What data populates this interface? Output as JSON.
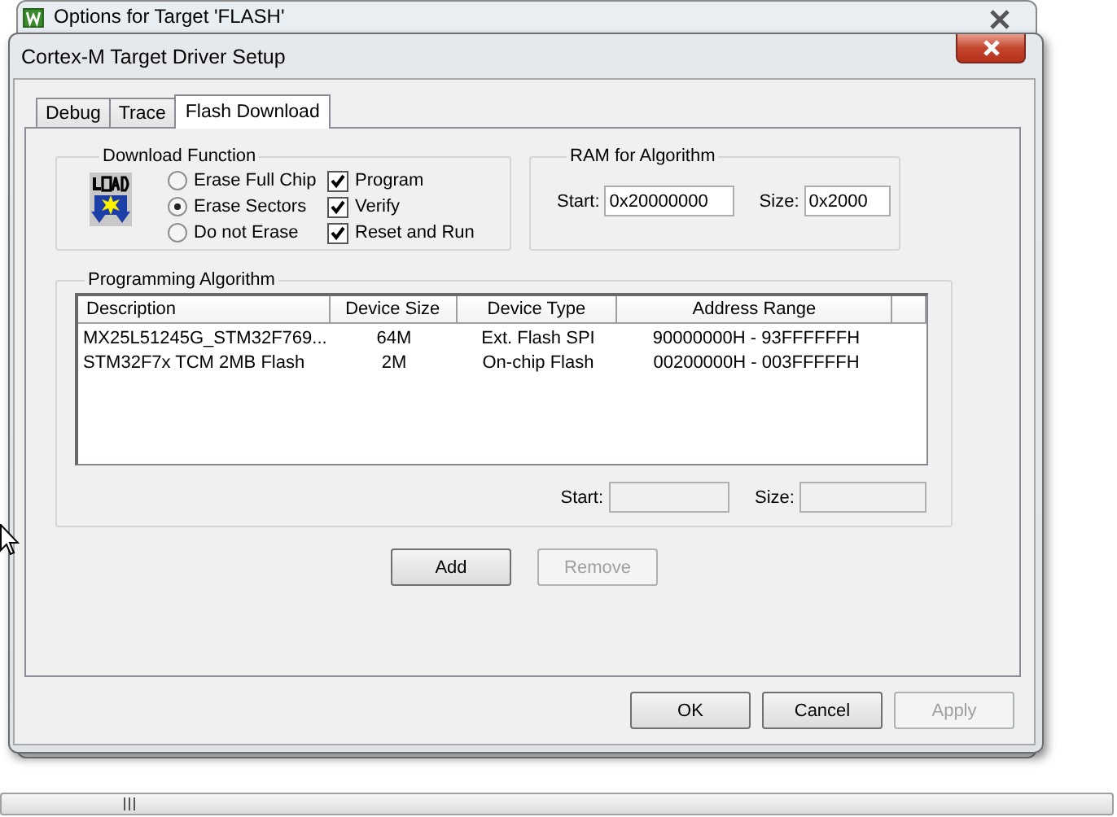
{
  "background_window": {
    "title": "Options for Target 'FLASH'"
  },
  "dialog": {
    "title": "Cortex-M Target Driver Setup"
  },
  "tabs": [
    {
      "label": "Debug",
      "selected": false
    },
    {
      "label": "Trace",
      "selected": false
    },
    {
      "label": "Flash Download",
      "selected": true
    }
  ],
  "download_function": {
    "title": "Download Function",
    "erase_options": [
      {
        "label": "Erase Full Chip",
        "selected": false
      },
      {
        "label": "Erase Sectors",
        "selected": true
      },
      {
        "label": "Do not Erase",
        "selected": false
      }
    ],
    "options": [
      {
        "label": "Program",
        "checked": true
      },
      {
        "label": "Verify",
        "checked": true
      },
      {
        "label": "Reset and Run",
        "checked": true
      }
    ]
  },
  "ram_for_algorithm": {
    "title": "RAM for Algorithm",
    "start_label": "Start:",
    "start_value": "0x20000000",
    "size_label": "Size:",
    "size_value": "0x2000"
  },
  "programming_algorithm": {
    "title": "Programming Algorithm",
    "columns": [
      "Description",
      "Device Size",
      "Device Type",
      "Address Range"
    ],
    "rows": [
      [
        "MX25L51245G_STM32F769...",
        "64M",
        "Ext. Flash SPI",
        "90000000H - 93FFFFFFH"
      ],
      [
        "STM32F7x TCM 2MB Flash",
        "2M",
        "On-chip Flash",
        "00200000H - 003FFFFFH"
      ]
    ],
    "start_label": "Start:",
    "size_label": "Size:"
  },
  "algorithm_buttons": [
    {
      "label": "Add",
      "disabled": false
    },
    {
      "label": "Remove",
      "disabled": true
    }
  ],
  "dialog_buttons": [
    {
      "label": "OK",
      "disabled": false
    },
    {
      "label": "Cancel",
      "disabled": false
    },
    {
      "label": "Apply",
      "disabled": true
    }
  ]
}
